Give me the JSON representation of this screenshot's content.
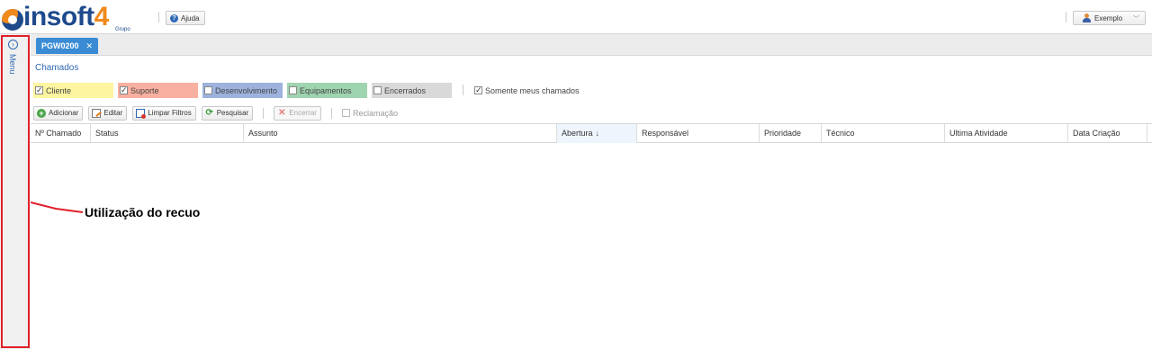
{
  "header": {
    "logo_text": "insoft",
    "logo_number": "4",
    "logo_sub": "Grupo",
    "help_label": "Ajuda",
    "user_label": "Exemplo"
  },
  "sidebar": {
    "menu_label": "Menu"
  },
  "tabs": [
    {
      "label": "PGW0200",
      "active": true
    }
  ],
  "page_title": "Chamados",
  "filters": [
    {
      "label": "Cliente",
      "checked": true,
      "color": "#fdf5a0"
    },
    {
      "label": "Suporte",
      "checked": true,
      "color": "#f8b0a0"
    },
    {
      "label": "Desenvolvimento",
      "checked": false,
      "color": "#9db3de"
    },
    {
      "label": "Equipamentos",
      "checked": false,
      "color": "#9fd4b0"
    },
    {
      "label": "Encerrados",
      "checked": false,
      "color": "#d9d9d9"
    }
  ],
  "only_mine": {
    "label": "Somente meus chamados",
    "checked": true
  },
  "toolbar": {
    "add_label": "Adicionar",
    "edit_label": "Editar",
    "clear_label": "Limpar Filtros",
    "search_label": "Pesquisar",
    "close_label": "Encerrar",
    "claim_label": "Reclamação"
  },
  "grid": {
    "columns": [
      "Nº Chamado",
      "Status",
      "Assunto",
      "Abertura",
      "Responsável",
      "Prioridade",
      "Técnico",
      "Ultima Atividade",
      "Data Criação"
    ],
    "sorted_column": "Abertura",
    "sort_direction": "desc",
    "rows": []
  },
  "annotation": {
    "text": "Utilização do recuo",
    "color": "#e0202a"
  }
}
